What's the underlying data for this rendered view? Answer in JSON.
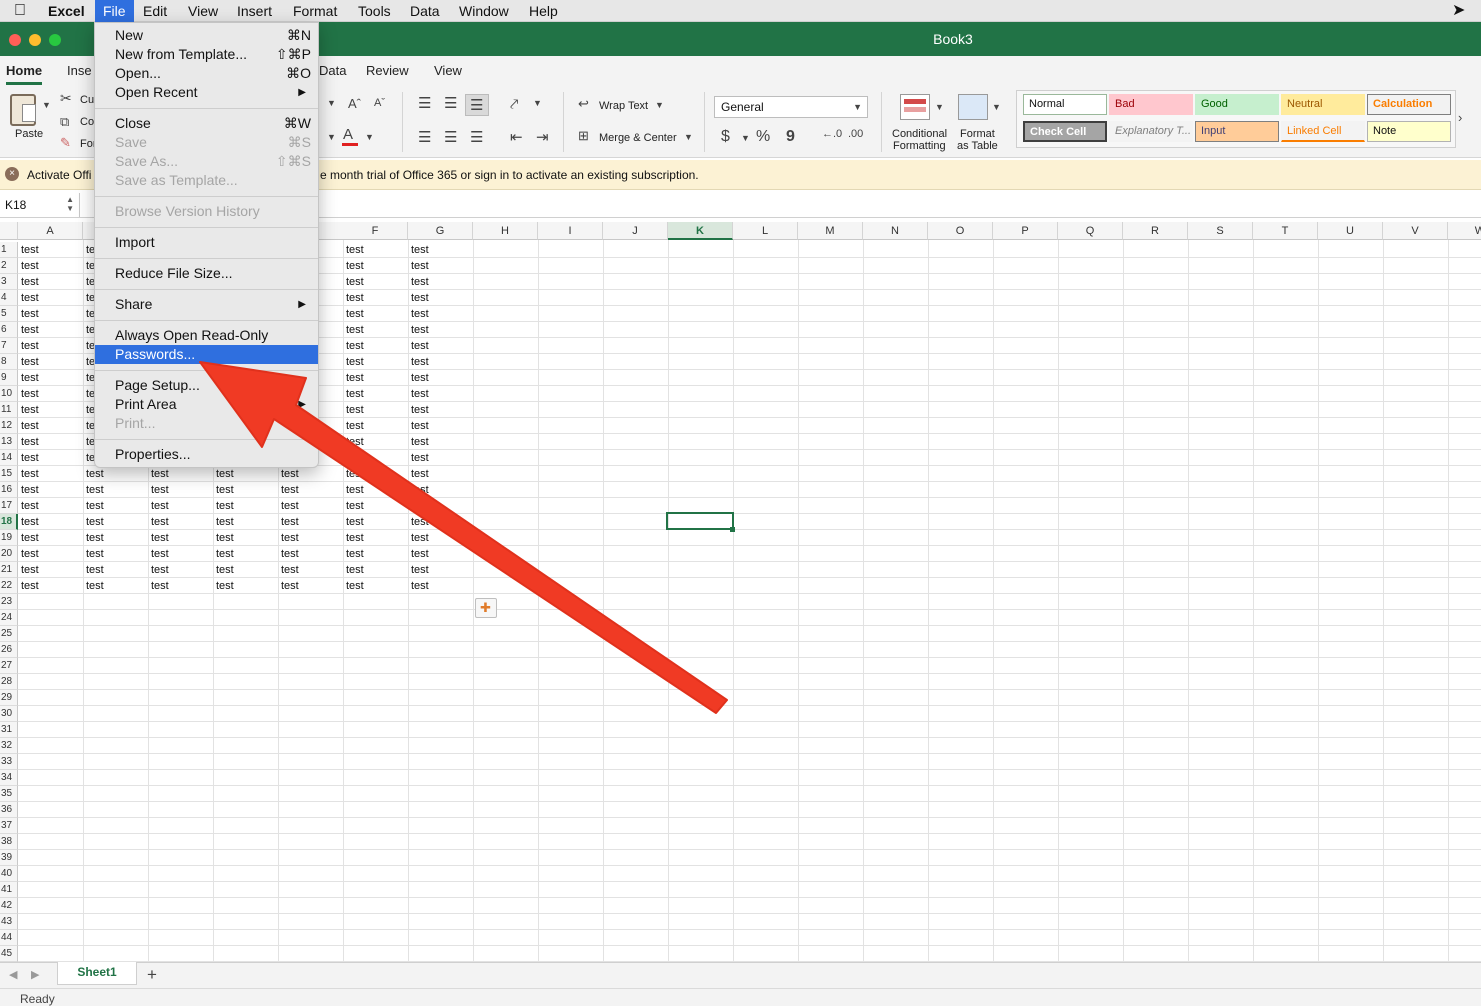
{
  "menubar": {
    "app": "Excel",
    "items": [
      "File",
      "Edit",
      "View",
      "Insert",
      "Format",
      "Tools",
      "Data",
      "Window",
      "Help"
    ]
  },
  "window": {
    "title": "Book3"
  },
  "ribbon_tabs": [
    "Home",
    "Inse",
    "Data",
    "Review",
    "View"
  ],
  "ribbon": {
    "paste": "Paste",
    "cut": "Cu",
    "copy": "Co",
    "format_painter": "For",
    "wrap_text": "Wrap Text",
    "merge_center": "Merge & Center",
    "number_format": "General",
    "currency": "$",
    "percent": "%",
    "comma": "9",
    "conditional_formatting_1": "Conditional",
    "conditional_formatting_2": "Formatting",
    "format_table_1": "Format",
    "format_table_2": "as Table",
    "styles": [
      {
        "label": "Normal",
        "bg": "#ffffff",
        "color": "#111111",
        "border": "#9ab89a"
      },
      {
        "label": "Bad",
        "bg": "#ffc7ce",
        "color": "#9c0006",
        "border": "#ffc7ce"
      },
      {
        "label": "Good",
        "bg": "#c6efce",
        "color": "#006100",
        "border": "#c6efce"
      },
      {
        "label": "Neutral",
        "bg": "#ffeb9c",
        "color": "#9c5700",
        "border": "#ffeb9c"
      },
      {
        "label": "Calculation",
        "bg": "#f2f2f2",
        "color": "#fa7d00",
        "border": "#7f7f7f"
      },
      {
        "label": "Check Cell",
        "bg": "#a5a5a5",
        "color": "#ffffff",
        "border": "#3f3f3f"
      },
      {
        "label": "Explanatory T...",
        "bg": "#f3f3f3",
        "color": "#7f7f7f",
        "border": "#f3f3f3"
      },
      {
        "label": "Input",
        "bg": "#ffcc99",
        "color": "#3f3f76",
        "border": "#7f7f7f"
      },
      {
        "label": "Linked Cell",
        "bg": "#f3f3f3",
        "color": "#fa7d00",
        "border": "#f3f3f3"
      },
      {
        "label": "Note",
        "bg": "#ffffcc",
        "color": "#111111",
        "border": "#b2b2b2"
      }
    ]
  },
  "activation_bar": {
    "left_text": "Activate Offi",
    "right_text": "e month trial of Office 365 or sign in to activate an existing subscription."
  },
  "formula_bar": {
    "name_box": "K18"
  },
  "grid": {
    "visible_column_headers": [
      "A",
      "F",
      "G",
      "H",
      "I",
      "J",
      "K",
      "L",
      "M",
      "N",
      "O",
      "P",
      "Q",
      "R",
      "S",
      "T",
      "U",
      "V",
      "W"
    ],
    "selected_cell": "K18",
    "cell_value": "test",
    "col_b_partial": "te",
    "row_count_shown": 45
  },
  "sheet_tabs": {
    "active": "Sheet1",
    "add": "+"
  },
  "status": {
    "text": "Ready"
  },
  "file_menu": {
    "items": [
      {
        "label": "New",
        "shortcut": "⌘N"
      },
      {
        "label": "New from Template...",
        "shortcut": "⇧⌘P"
      },
      {
        "label": "Open...",
        "shortcut": "⌘O"
      },
      {
        "label": "Open Recent",
        "submenu": true
      },
      {
        "label": "Close",
        "shortcut": "⌘W"
      },
      {
        "label": "Save",
        "shortcut": "⌘S",
        "disabled": true
      },
      {
        "label": "Save As...",
        "shortcut": "⇧⌘S",
        "disabled": true
      },
      {
        "label": "Save as Template...",
        "disabled": true
      },
      {
        "label": "Browse Version History",
        "disabled": true
      },
      {
        "label": "Import"
      },
      {
        "label": "Reduce File Size..."
      },
      {
        "label": "Share",
        "submenu": true
      },
      {
        "label": "Always Open Read-Only"
      },
      {
        "label": "Passwords...",
        "highlighted": true
      },
      {
        "label": "Page Setup..."
      },
      {
        "label": "Print Area",
        "submenu": true
      },
      {
        "label": "Print...",
        "disabled": true
      },
      {
        "label": "Properties..."
      }
    ]
  },
  "colors": {
    "excel_green": "#217346",
    "menu_highlight": "#2f6fdf",
    "arrow_red": "#f03a24"
  }
}
